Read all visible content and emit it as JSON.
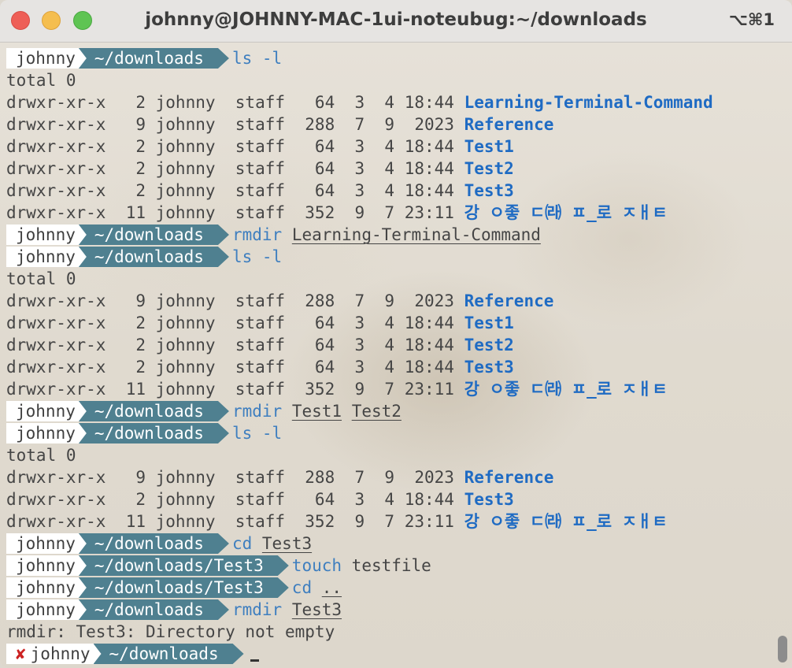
{
  "window": {
    "title": "johnny@JOHNNY-MAC-1ui-noteubug:~/downloads",
    "shortcut": "⌥⌘1"
  },
  "prompt": {
    "user": "johnny",
    "dir": "~/downloads",
    "dir_test3": "~/downloads/Test3"
  },
  "commands": {
    "ls": "ls -l",
    "rmdir": "rmdir",
    "cd": "cd",
    "touch": "touch",
    "arg_ltc": "Learning-Terminal-Command",
    "arg_test1": "Test1",
    "arg_test2": "Test2",
    "arg_test3": "Test3",
    "arg_testfile": "testfile",
    "arg_dotdot": ".."
  },
  "total": "total 0",
  "listing1": [
    {
      "info": "drwxr-xr-x   2 johnny  staff   64  3  4 18:44 ",
      "name": "Learning-Terminal-Command"
    },
    {
      "info": "drwxr-xr-x   9 johnny  staff  288  7  9  2023 ",
      "name": "Reference"
    },
    {
      "info": "drwxr-xr-x   2 johnny  staff   64  3  4 18:44 ",
      "name": "Test1"
    },
    {
      "info": "drwxr-xr-x   2 johnny  staff   64  3  4 18:44 ",
      "name": "Test2"
    },
    {
      "info": "drwxr-xr-x   2 johnny  staff   64  3  4 18:44 ",
      "name": "Test3"
    },
    {
      "info": "drwxr-xr-x  11 johnny  staff  352  9  7 23:11 ",
      "name": "강 ㅇ좋 ㄷ㈑ ㅍ_로 ㅈㅐㅌ"
    }
  ],
  "listing2": [
    {
      "info": "drwxr-xr-x   9 johnny  staff  288  7  9  2023 ",
      "name": "Reference"
    },
    {
      "info": "drwxr-xr-x   2 johnny  staff   64  3  4 18:44 ",
      "name": "Test1"
    },
    {
      "info": "drwxr-xr-x   2 johnny  staff   64  3  4 18:44 ",
      "name": "Test2"
    },
    {
      "info": "drwxr-xr-x   2 johnny  staff   64  3  4 18:44 ",
      "name": "Test3"
    },
    {
      "info": "drwxr-xr-x  11 johnny  staff  352  9  7 23:11 ",
      "name": "강 ㅇ좋 ㄷ㈑ ㅍ_로 ㅈㅐㅌ"
    }
  ],
  "listing3": [
    {
      "info": "drwxr-xr-x   9 johnny  staff  288  7  9  2023 ",
      "name": "Reference"
    },
    {
      "info": "drwxr-xr-x   2 johnny  staff   64  3  4 18:44 ",
      "name": "Test3"
    },
    {
      "info": "drwxr-xr-x  11 johnny  staff  352  9  7 23:11 ",
      "name": "강 ㅇ좋 ㄷ㈑ ㅍ_로 ㅈㅐㅌ"
    }
  ],
  "error": "rmdir: Test3: Directory not empty",
  "colors": {
    "dir_segment": "#4f8090",
    "command": "#3f7fbf",
    "dir_name": "#1f6bc3",
    "error_x": "#cc2222"
  },
  "icons": {
    "error": "✘"
  }
}
